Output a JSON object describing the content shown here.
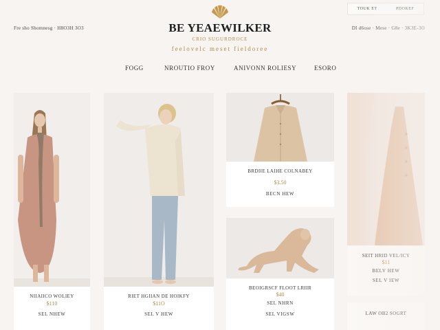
{
  "header": {
    "util_left": "Fre sho Shomnesg  ·  H8O3H 3O3",
    "util_right": "DI d6ose  ·  Mese  ·  G8e  ·  3K3E-3O",
    "account_links": [
      "TOUK ET",
      "PDOKEF"
    ],
    "brand": "BE YEAEWILKER",
    "subline": "CRIO SUGURDROCE",
    "tagline": "feelovelc meset fieldoree",
    "logo_icon": "shell-fan-logo-icon"
  },
  "nav": {
    "items": [
      "FOGG",
      "NROUTIO FROY",
      "ANIVONN ROLIESY",
      "ESORO"
    ]
  },
  "products": [
    {
      "name": "NIIAIICO WOLIEY",
      "price": "$110",
      "action": "SEL NHEW"
    },
    {
      "name": "RIET HGIIAN DE HOIKFY",
      "price": "$11O",
      "action": "SEL V HEW"
    },
    {
      "name": "BRDIIE LAIHE COLNABEY",
      "price": "$3.50",
      "action": "BECN HEW"
    },
    {
      "name": "BEOIGRSCF FLOOT LRIIR",
      "price": "$40",
      "action": "SEL NHRN"
    },
    {
      "name": "",
      "price": "",
      "action": "SEL VIGSW"
    },
    {
      "name": "SEIT HRID VEL/ICY",
      "price": "$11",
      "action": "BELV HEW"
    },
    {
      "name": "",
      "price": "",
      "action": "SEL V IEW"
    },
    {
      "name": "LAW OB2 SOGRT",
      "price": "",
      "action": ""
    }
  ],
  "colors": {
    "accent": "#b08a4a",
    "card": "#ffffff",
    "background": "#f7f4f1"
  }
}
